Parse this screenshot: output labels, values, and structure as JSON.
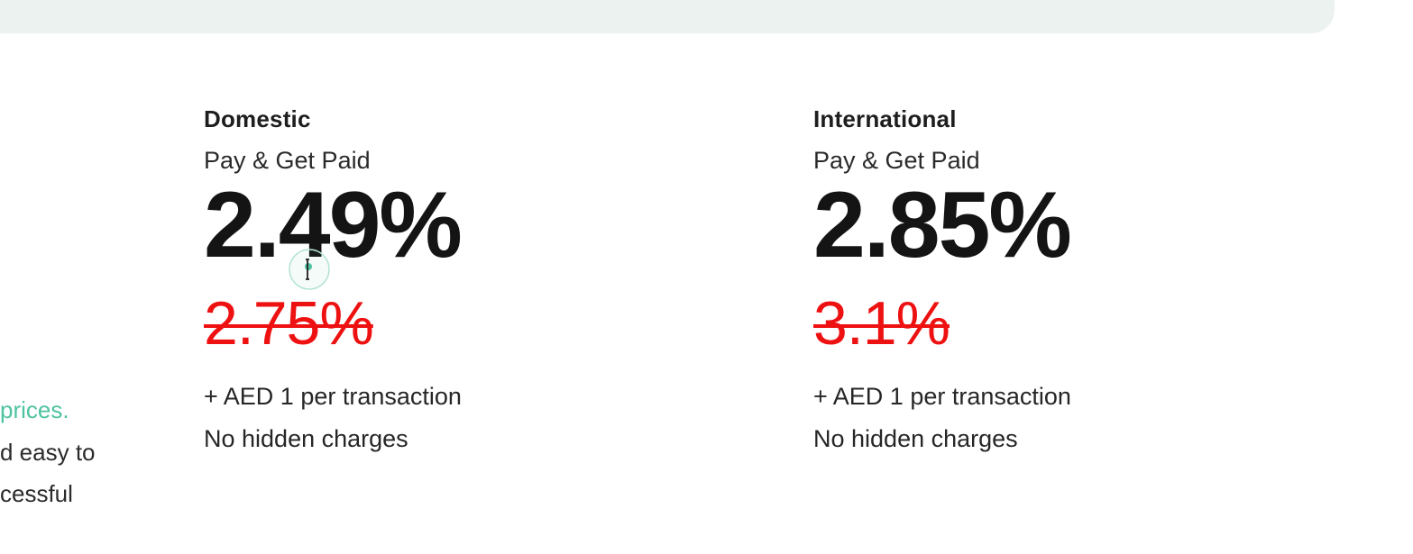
{
  "left_panel": {
    "line1": "prices.",
    "line2": "d easy to",
    "line3": "cessful"
  },
  "domestic": {
    "title": "Domestic",
    "subtitle": "Pay & Get Paid",
    "rate": "2.49%",
    "old_rate": "2.75%",
    "fee": "+ AED 1 per transaction",
    "note": "No hidden charges"
  },
  "international": {
    "title": "International",
    "subtitle": "Pay & Get Paid",
    "rate": "2.85%",
    "old_rate": "3.1%",
    "fee": "+ AED 1 per transaction",
    "note": "No hidden charges"
  },
  "colors": {
    "accent": "#4fc3a1",
    "strike_price": "#ee1111",
    "banner": "#ebf2f0"
  },
  "icons": {
    "cursor": "text-cursor-icon"
  }
}
